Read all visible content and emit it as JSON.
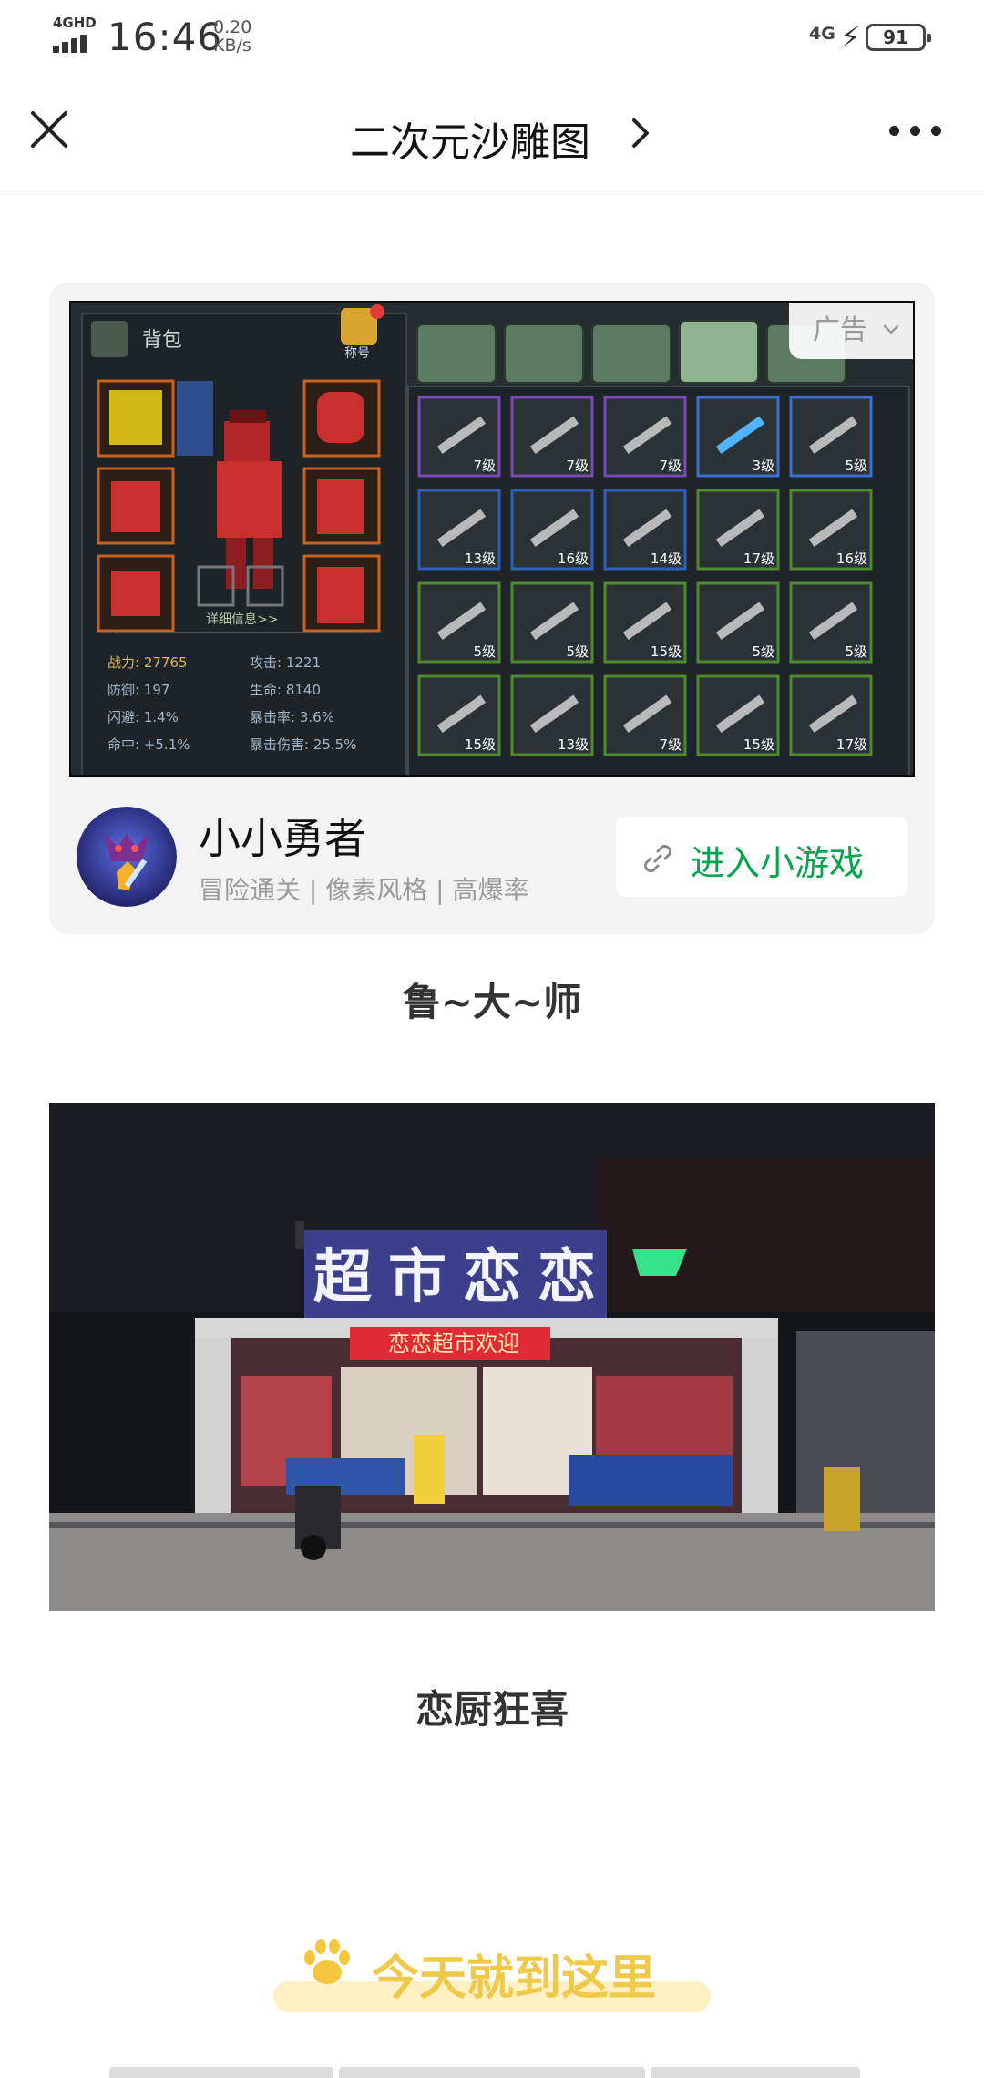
{
  "status_bar": {
    "network_type": "4GHD",
    "time": "16:46",
    "speed_value": "0.20",
    "speed_unit": "KB/s",
    "right_network": "4G",
    "battery": "91"
  },
  "title_bar": {
    "title": "二次元沙雕图",
    "close_icon": "close-icon",
    "more_icon": "more-icon"
  },
  "ad": {
    "label": "广告",
    "game_name": "小小勇者",
    "tags": "冒险通关 | 像素风格 | 高爆率",
    "enter_button": "进入小游戏",
    "screenshot": {
      "backpack_label": "背包",
      "title_badge": "称号",
      "detail_link": "详细信息>>",
      "stats": [
        {
          "left": "战力: 27765",
          "right": "攻击: 1221"
        },
        {
          "left": "防御: 197",
          "right": "生命: 8140"
        },
        {
          "left": "闪避: 1.4%",
          "right": "暴击率: 3.6%"
        },
        {
          "left": "命中: +5.1%",
          "right": "暴击伤害: 25.5%"
        }
      ],
      "item_levels": [
        [
          "7级",
          "7级",
          "7级",
          "3级",
          "5级"
        ],
        [
          "13级",
          "16级",
          "14级",
          "17级",
          "16级"
        ],
        [
          "5级",
          "5级",
          "15级",
          "5级",
          "5级"
        ],
        [
          "15级",
          "13级",
          "7级",
          "15级",
          "17级"
        ]
      ],
      "item_colors": [
        "#7a4bb5",
        "#7a4bb5",
        "#7a4bb5",
        "#3b6fd0",
        "#3b6fd0",
        "#2f5fb8",
        "#2f5fb8",
        "#2f5fb8",
        "#4f8a2e",
        "#4f8a2e",
        "#4f8a2e",
        "#4f8a2e",
        "#4f8a2e",
        "#4f8a2e",
        "#4f8a2e",
        "#4f8a2e",
        "#4f8a2e",
        "#4f8a2e",
        "#4f8a2e",
        "#4f8a2e"
      ]
    }
  },
  "caption_1": "鲁~大~师",
  "photo": {
    "store_sign": "超市恋恋",
    "banner": "恋恋超市欢迎"
  },
  "caption_2": "恋厨狂喜",
  "end_text": "今天就到这里",
  "colors": {
    "accent_green": "#07a44f",
    "end_text": "#f0c84a"
  }
}
